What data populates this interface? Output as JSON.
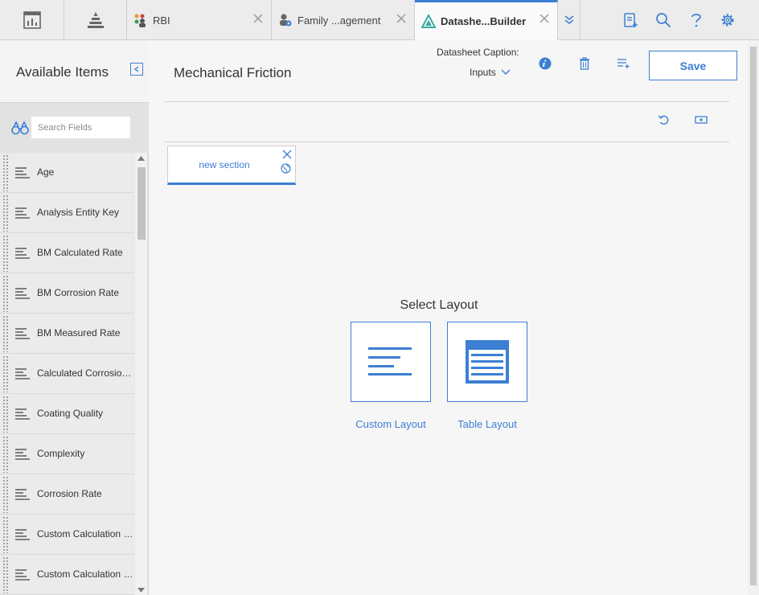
{
  "tabs": [
    {
      "label": "RBI",
      "icon": "rbi-people-icon"
    },
    {
      "label": "Family ...agement",
      "icon": "family-management-icon"
    },
    {
      "label": "Datashe...Builder",
      "icon": "datasheet-builder-icon",
      "active": true
    }
  ],
  "sidebar": {
    "title": "Available Items",
    "search_placeholder": "Search Fields",
    "items": [
      {
        "label": "Age"
      },
      {
        "label": "Analysis Entity Key"
      },
      {
        "label": "BM Calculated Rate"
      },
      {
        "label": "BM Corrosion Rate"
      },
      {
        "label": "BM Measured Rate"
      },
      {
        "label": "Calculated Corrosion Rate"
      },
      {
        "label": "Coating Quality"
      },
      {
        "label": "Complexity"
      },
      {
        "label": "Corrosion Rate"
      },
      {
        "label": "Custom Calculation Parameter"
      },
      {
        "label": "Custom Calculation Unit"
      }
    ]
  },
  "main": {
    "title": "Mechanical Friction",
    "caption_label": "Datasheet Caption:",
    "caption_value": "Inputs",
    "save_label": "Save",
    "section_name": "new section",
    "select_layout_title": "Select Layout",
    "layouts": [
      {
        "label": "Custom Layout"
      },
      {
        "label": "Table Layout"
      }
    ]
  },
  "colors": {
    "accent": "#3c7fd4",
    "tab_bar": "#ececec",
    "sidebar_bg": "#e9e9e9"
  }
}
